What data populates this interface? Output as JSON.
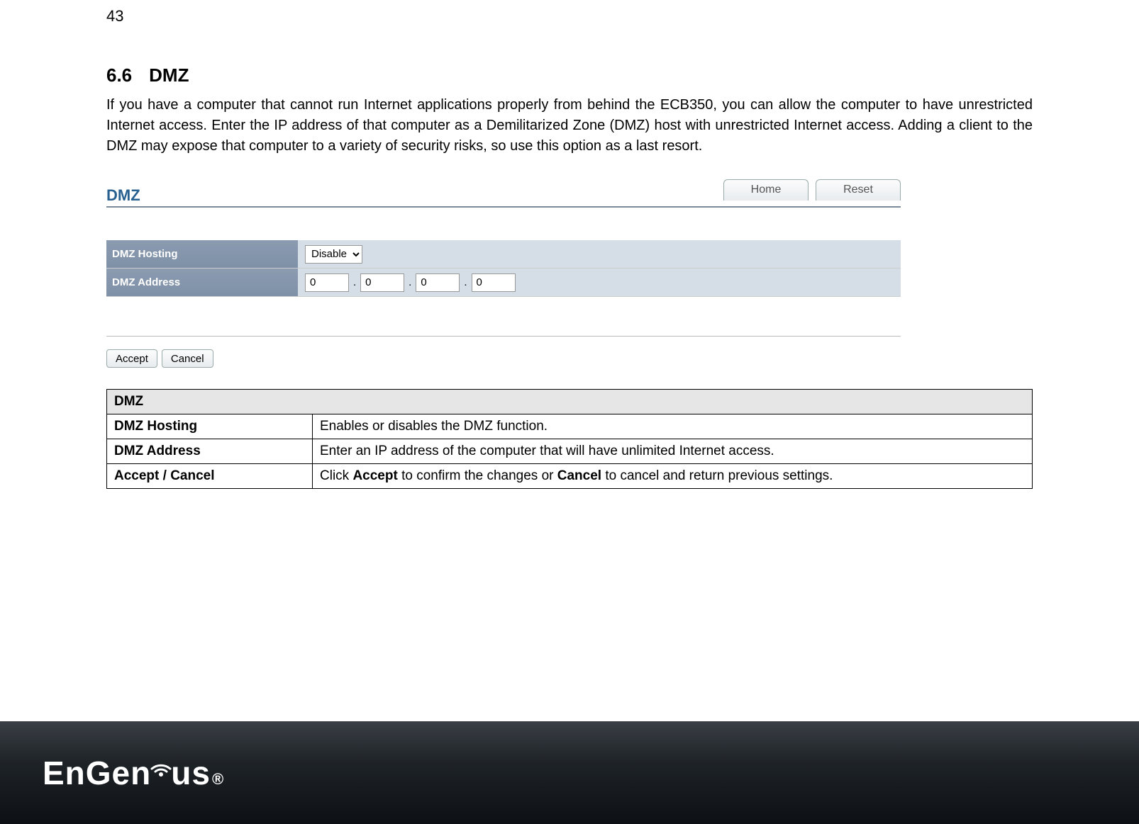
{
  "page_number": "43",
  "heading_number": "6.6",
  "heading_title": "DMZ",
  "body_paragraph": "If you have a computer that cannot run Internet applications properly from behind the ECB350, you can allow the computer to have unrestricted Internet access. Enter the IP address of that computer as a Demilitarized Zone (DMZ) host with unrestricted Internet access. Adding a client to the DMZ may expose that computer to a variety of security risks, so use this option as a last resort.",
  "panel": {
    "title": "DMZ",
    "home_btn": "Home",
    "reset_btn": "Reset",
    "rows": {
      "hosting_label": "DMZ Hosting",
      "hosting_value": "Disable",
      "address_label": "DMZ Address",
      "ip": [
        "0",
        "0",
        "0",
        "0"
      ]
    },
    "accept_btn": "Accept",
    "cancel_btn": "Cancel"
  },
  "table": {
    "header": "DMZ",
    "rows": [
      {
        "key": "DMZ Hosting",
        "desc_plain": "Enables or disables the DMZ function."
      },
      {
        "key": "DMZ Address",
        "desc_plain": "Enter an IP address of the computer that will have unlimited Internet access."
      },
      {
        "key": "Accept / Cancel",
        "desc_pre": "Click ",
        "b1": "Accept",
        "mid": " to confirm the changes or ",
        "b2": "Cancel",
        "post": " to cancel and return previous settings."
      }
    ]
  },
  "footer_logo": {
    "part1": "EnGen",
    "part2": "us",
    "reg": "®"
  }
}
